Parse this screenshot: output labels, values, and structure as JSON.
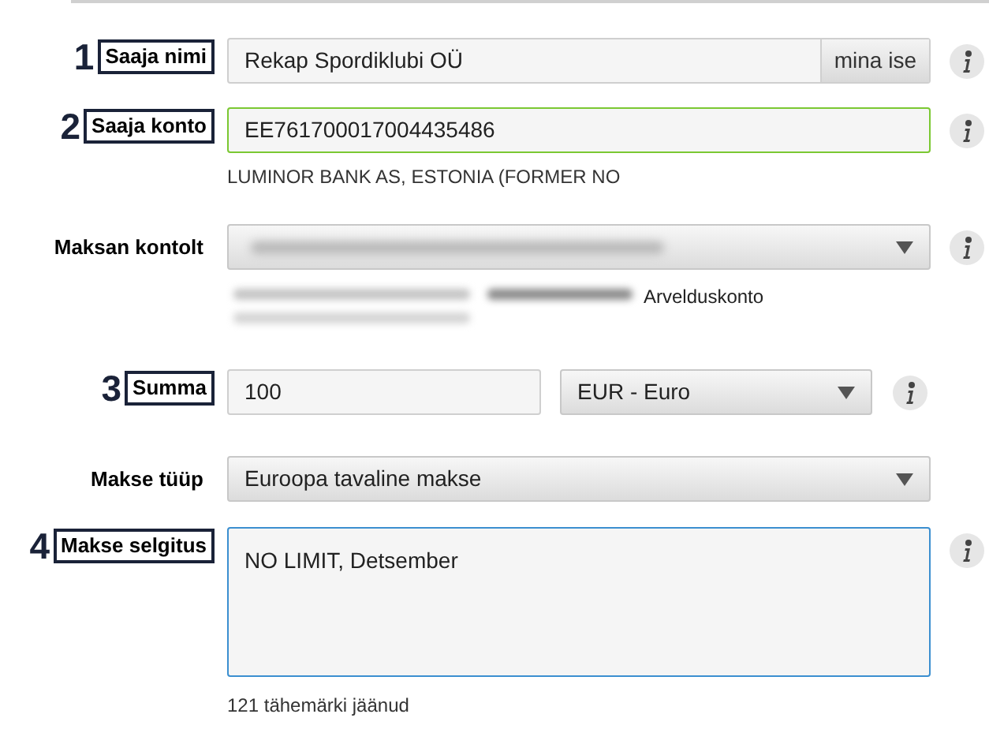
{
  "fields": [
    {
      "kind": "text_with_button",
      "number": "1",
      "label": "Saaja nimi",
      "value": "Rekap Spordiklubi OÜ",
      "button": "mina ise",
      "valid": false,
      "info": true
    },
    {
      "kind": "text",
      "number": "2",
      "label": "Saaja konto",
      "value": "EE761700017004435486",
      "valid": true,
      "hint": "LUMINOR BANK AS, ESTONIA (FORMER NO",
      "info": true
    },
    {
      "kind": "account_select",
      "label": "Maksan kontolt",
      "redacted": true,
      "hint": "Arvelduskonto",
      "info": true
    },
    {
      "kind": "amount",
      "number": "3",
      "label": "Summa",
      "value": "100",
      "currency": "EUR - Euro",
      "info": true
    },
    {
      "kind": "select",
      "label": "Makse tüüp",
      "value": "Euroopa tavaline makse",
      "info": false
    },
    {
      "kind": "textarea",
      "number": "4",
      "label": "Makse selgitus",
      "value": "NO LIMIT, Detsember",
      "focused": true,
      "hint": "121 tähemärki jäänud",
      "info": true
    }
  ]
}
